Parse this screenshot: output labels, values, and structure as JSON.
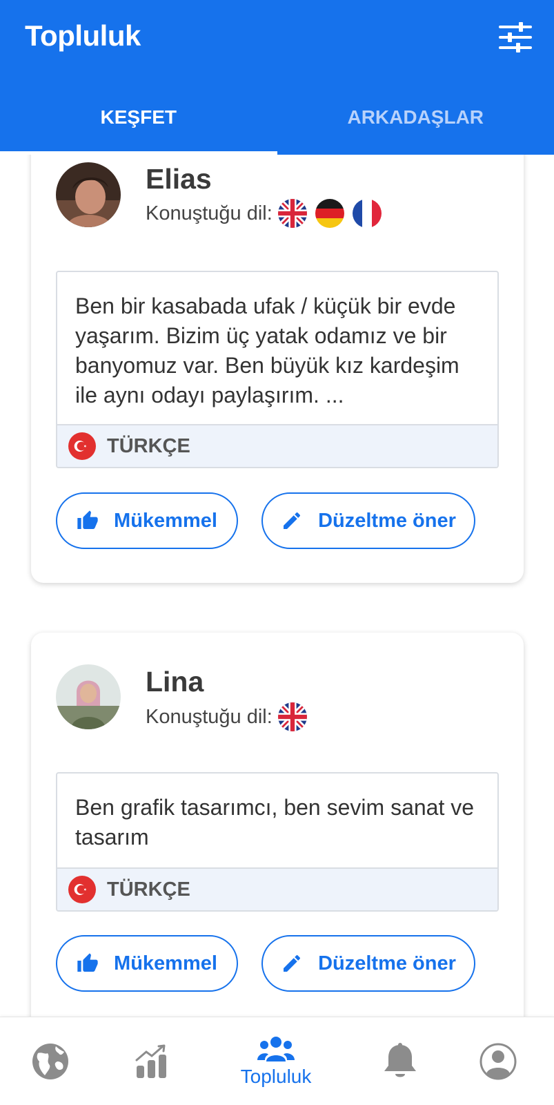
{
  "app": {
    "title": "Topluluk",
    "accent_color": "#1672EC",
    "filter_icon": "sliders-icon"
  },
  "tabs": [
    {
      "label": "KEŞFET",
      "active": true
    },
    {
      "label": "ARKADAŞLAR",
      "active": false
    }
  ],
  "posts": [
    {
      "name": "Elias",
      "languages_label": "Konuştuğu dil:",
      "languages": [
        "uk-flag-icon",
        "germany-flag-icon",
        "france-flag-icon"
      ],
      "text": "Ben bir kasabada ufak / küçük bir evde yaşarım. Bizim üç yatak odamız ve bir banyomuz var. Ben büyük kız kardeşim ile aynı odayı paylaşırım. ...",
      "post_language": "TÜRKÇE",
      "like_label": "Mükemmel",
      "edit_label": "Düzeltme öner"
    },
    {
      "name": "Lina",
      "languages_label": "Konuştuğu dil:",
      "languages": [
        "uk-flag-icon"
      ],
      "text": "Ben grafik tasarımcı, ben sevim sanat ve tasarım",
      "post_language": "TÜRKÇE",
      "like_label": "Mükemmel",
      "edit_label": "Düzeltme öner"
    }
  ],
  "bottom_nav": {
    "items": [
      {
        "icon": "globe-icon",
        "label": "",
        "active": false
      },
      {
        "icon": "stats-icon",
        "label": "",
        "active": false
      },
      {
        "icon": "community-icon",
        "label": "Topluluk",
        "active": true
      },
      {
        "icon": "bell-icon",
        "label": "",
        "active": false
      },
      {
        "icon": "profile-icon",
        "label": "",
        "active": false
      }
    ]
  }
}
